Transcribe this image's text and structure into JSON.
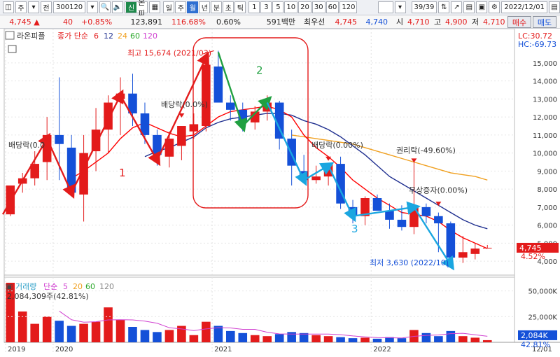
{
  "toolbar": {
    "period_sel": "주",
    "period_type": "전",
    "code": "300120",
    "sin_badge": "신",
    "stock_name": "라온피플",
    "periods": [
      "일",
      "주",
      "월",
      "년",
      "분",
      "초",
      "틱"
    ],
    "active_period": "월",
    "intervals": [
      "1",
      "3",
      "5",
      "10",
      "20",
      "30",
      "60",
      "120"
    ],
    "page_counter": "39/39",
    "date": "2022/12/01"
  },
  "quote": {
    "price": "4,745",
    "change": "40",
    "change_pct": "+0.85%",
    "volume": "123,891",
    "vol_ratio": "116.68%",
    "turnover": "0.60%",
    "trade_value": "591백만",
    "best_ask_label": "최우선",
    "best_ask": "4,745",
    "best_bid": "4,740",
    "open_label": "시",
    "open": "4,710",
    "high_label": "고",
    "high": "4,900",
    "low_label": "저",
    "low": "4,710",
    "buy_label": "매수",
    "sell_label": "매도"
  },
  "legend": {
    "name": "라온피플",
    "ma_label": "종가 단순",
    "ma_periods": [
      "6",
      "12",
      "24",
      "60",
      "120"
    ],
    "lc": "LC:30.72",
    "hc": "HC:-69.73"
  },
  "volume_legend": {
    "label": "거래량",
    "ma_label": "단순",
    "ma_periods": [
      "5",
      "20",
      "60",
      "120"
    ],
    "value_text": "2,084,309주(42.81%)",
    "axis_ticks": [
      "50,000K",
      "25,000K"
    ],
    "current_box": "2,084K",
    "current_pct": "42.81%"
  },
  "annotations": {
    "high_label": "최고 15,674 (2021/03)",
    "low_label": "최저 3,630 (2022/10)",
    "dividend": "배당락(0.0",
    "dividend2": "배당락(0.0%)",
    "dividend3": "배당락(0.00%)",
    "rights": "권리락(-49.60%)",
    "bonus": "무상증자(0.00%)",
    "wave_labels": [
      "1",
      "2",
      "3"
    ]
  },
  "price_label": {
    "value": "4,745",
    "pct": "4.52%"
  },
  "colors": {
    "up": "#e31b1b",
    "down": "#1450d8",
    "ma6": "#ff0000",
    "ma12": "#1f2f8f",
    "ma24": "#f0a020",
    "ma60": "#2ba82b",
    "ma120": "#d040d0"
  },
  "chart_data": {
    "type": "candlestick",
    "y_ticks": [
      4000,
      5000,
      6000,
      7000,
      8000,
      9000,
      10000,
      11000,
      12000,
      13000,
      14000,
      15000
    ],
    "x_labels": [
      "2019",
      "2020",
      "2021",
      "2022",
      "12/01"
    ],
    "candles": [
      {
        "o": 6600,
        "h": 8200,
        "l": 6500,
        "c": 8200
      },
      {
        "o": 8300,
        "h": 8900,
        "l": 7800,
        "c": 8600
      },
      {
        "o": 8600,
        "h": 10100,
        "l": 8200,
        "c": 9400
      },
      {
        "o": 9500,
        "h": 12000,
        "l": 8500,
        "c": 11000
      },
      {
        "o": 11000,
        "h": 14200,
        "l": 8500,
        "c": 10500
      },
      {
        "o": 10300,
        "h": 11000,
        "l": 8000,
        "c": 7800
      },
      {
        "o": 7700,
        "h": 11000,
        "l": 6200,
        "c": 10000
      },
      {
        "o": 10100,
        "h": 12500,
        "l": 9000,
        "c": 11300
      },
      {
        "o": 11300,
        "h": 13200,
        "l": 10000,
        "c": 12800
      },
      {
        "o": 13000,
        "h": 14200,
        "l": 11000,
        "c": 13300
      },
      {
        "o": 13300,
        "h": 14400,
        "l": 11500,
        "c": 12200
      },
      {
        "o": 12200,
        "h": 12800,
        "l": 10500,
        "c": 11000
      },
      {
        "o": 11000,
        "h": 11300,
        "l": 9300,
        "c": 9900
      },
      {
        "o": 9800,
        "h": 11200,
        "l": 9200,
        "c": 10800
      },
      {
        "o": 10400,
        "h": 11500,
        "l": 9600,
        "c": 11500
      },
      {
        "o": 11200,
        "h": 12200,
        "l": 10800,
        "c": 11600
      },
      {
        "o": 11500,
        "h": 15300,
        "l": 11200,
        "c": 14900
      },
      {
        "o": 14800,
        "h": 15674,
        "l": 13200,
        "c": 12800
      },
      {
        "o": 12800,
        "h": 13200,
        "l": 11800,
        "c": 12400
      },
      {
        "o": 12400,
        "h": 12800,
        "l": 11200,
        "c": 11700
      },
      {
        "o": 11700,
        "h": 12600,
        "l": 11300,
        "c": 12300
      },
      {
        "o": 12300,
        "h": 13200,
        "l": 11800,
        "c": 12800
      },
      {
        "o": 12800,
        "h": 12900,
        "l": 10200,
        "c": 10800
      },
      {
        "o": 10800,
        "h": 11300,
        "l": 8200,
        "c": 9300
      },
      {
        "o": 9000,
        "h": 9900,
        "l": 8400,
        "c": 8500
      },
      {
        "o": 8500,
        "h": 9300,
        "l": 8300,
        "c": 8700
      },
      {
        "o": 8700,
        "h": 9400,
        "l": 8200,
        "c": 9400
      },
      {
        "o": 9400,
        "h": 9800,
        "l": 6900,
        "c": 7200
      },
      {
        "o": 7000,
        "h": 7400,
        "l": 6100,
        "c": 6500
      },
      {
        "o": 6500,
        "h": 7600,
        "l": 6000,
        "c": 7500
      },
      {
        "o": 7500,
        "h": 7700,
        "l": 6900,
        "c": 6800
      },
      {
        "o": 6800,
        "h": 7200,
        "l": 5800,
        "c": 6300
      },
      {
        "o": 6300,
        "h": 7100,
        "l": 5700,
        "c": 5900
      },
      {
        "o": 5900,
        "h": 9600,
        "l": 5500,
        "c": 7000
      },
      {
        "o": 7000,
        "h": 7200,
        "l": 6100,
        "c": 6500
      },
      {
        "o": 6500,
        "h": 6700,
        "l": 4500,
        "c": 6100
      },
      {
        "o": 6100,
        "h": 6200,
        "l": 3630,
        "c": 4200
      },
      {
        "o": 4200,
        "h": 5400,
        "l": 3900,
        "c": 4500
      },
      {
        "o": 4400,
        "h": 5000,
        "l": 4100,
        "c": 4700
      },
      {
        "o": 4710,
        "h": 4900,
        "l": 4710,
        "c": 4745
      }
    ],
    "volume_k": [
      58000,
      30000,
      18000,
      25000,
      21000,
      16000,
      18000,
      20000,
      34000,
      22000,
      15000,
      12000,
      10000,
      12000,
      16000,
      7000,
      20000,
      16000,
      11000,
      9000,
      7000,
      6000,
      8000,
      10000,
      9000,
      7000,
      6000,
      5000,
      4000,
      4500,
      3500,
      5000,
      4000,
      12000,
      9000,
      6000,
      11000,
      6000,
      4500,
      2084
    ],
    "ma6": [
      null,
      null,
      null,
      null,
      null,
      8600,
      9000,
      9500,
      10000,
      10800,
      11400,
      11700,
      11400,
      11100,
      10900,
      11000,
      11500,
      12000,
      12300,
      12400,
      12500,
      12600,
      12400,
      12000,
      11000,
      10300,
      9800,
      9200,
      8500,
      8000,
      7500,
      7100,
      6700,
      6600,
      6500,
      6200,
      5700,
      5300,
      5000,
      4700
    ],
    "ma12": [
      null,
      null,
      null,
      null,
      null,
      null,
      null,
      null,
      null,
      null,
      null,
      9800,
      10100,
      10300,
      10600,
      10900,
      11400,
      11700,
      11900,
      12000,
      12100,
      12200,
      12200,
      12100,
      11800,
      11600,
      11300,
      10900,
      10400,
      9900,
      9300,
      8700,
      8300,
      7900,
      7500,
      7100,
      6700,
      6300,
      6000,
      5800
    ],
    "ma24": [
      null,
      null,
      null,
      null,
      null,
      null,
      null,
      null,
      null,
      null,
      null,
      null,
      null,
      null,
      null,
      null,
      null,
      null,
      null,
      null,
      null,
      null,
      null,
      11000,
      10900,
      10800,
      10700,
      10600,
      10500,
      10300,
      10100,
      9900,
      9700,
      9500,
      9300,
      9100,
      8900,
      8800,
      8700,
      8500
    ]
  }
}
